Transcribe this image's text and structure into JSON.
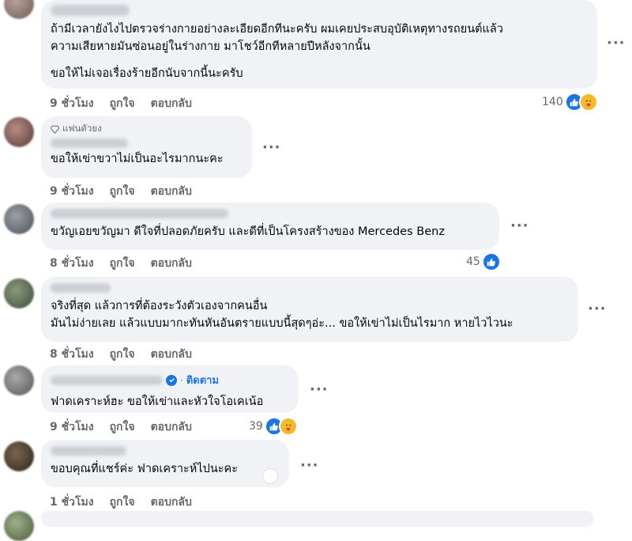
{
  "comments": [
    {
      "lines": [
        "ถ้ามีเวลายังไงไปตรวจร่างกายอย่างละเอียดอีกทีนะครับ ผมเคยประสบอุบัติเหตุทางรถยนต์แล้ว",
        "ความเสียหายมันซ่อนอยู่ในร่างกาย มาโชว์อีกทีหลายปีหลังจากนั้น",
        "ขอให้ไม่เจอเรื่องร้ายอีกนับจากนี้นะครับ"
      ],
      "time": "9 ชั่วโมง",
      "like": "ถูกใจ",
      "reply": "ตอบกลับ",
      "reactions": "140"
    },
    {
      "badge": "แฟนตัวยง",
      "lines": [
        "ขอให้เข่าขวาไม่เป็นอะไรมากนะคะ"
      ],
      "time": "9 ชั่วโมง",
      "like": "ถูกใจ",
      "reply": "ตอบกลับ"
    },
    {
      "lines": [
        "ขวัญเอยขวัญมา ดีใจที่ปลอดภัยครับ และดีที่เป็นโครงสร้างของ Mercedes Benz"
      ],
      "time": "8 ชั่วโมง",
      "like": "ถูกใจ",
      "reply": "ตอบกลับ",
      "reactions": "45"
    },
    {
      "lines": [
        "จริงที่สุด แล้วการที่ต้องระวังตัวเองจากคนอื่น",
        "มันไม่ง่ายเลย แล้วแบบมากะทันหันอันตรายแบบนี้สุดๆอ่ะ... ขอให้เข่าไม่เป็นไรมาก หายไวไวนะ"
      ],
      "time": "8 ชั่วโมง",
      "like": "ถูกใจ",
      "reply": "ตอบกลับ"
    },
    {
      "follow": "ติดตาม",
      "lines": [
        "ฟาดเคราะห์ฮะ ขอให้เข่าและหัวใจโอเคเน้อ"
      ],
      "time": "9 ชั่วโมง",
      "like": "ถูกใจ",
      "reply": "ตอบกลับ",
      "reactions": "39"
    },
    {
      "lines": [
        "ขอบคุณที่แชร์ค่ะ ฟาดเคราะห์ไปนะคะ"
      ],
      "time": "1 ชั่วโมง",
      "like": "ถูกใจ",
      "reply": "ตอบกลับ"
    }
  ],
  "colors": {
    "accent": "#1b74e4",
    "bubble": "#f0f2f5",
    "meta": "#65676b"
  }
}
